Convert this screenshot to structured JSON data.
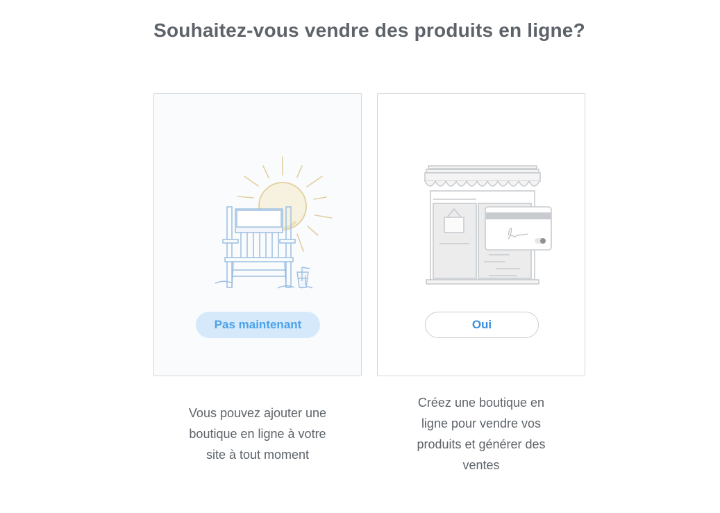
{
  "heading": "Souhaitez-vous vendre des produits en ligne?",
  "options": [
    {
      "button_label": "Pas maintenant",
      "illustration_icon": "beach-chair-sun-icon",
      "description_lines": [
        "Vous pouvez ajouter une",
        "boutique en ligne à votre",
        "site à tout moment"
      ]
    },
    {
      "button_label": "Oui",
      "illustration_icon": "storefront-card-icon",
      "description_lines": [
        "Créez une boutique en",
        "ligne pour vendre vos",
        "produits et générer des",
        "ventes"
      ]
    }
  ],
  "colors": {
    "heading_text": "#5d6369",
    "primary_blue": "#3a8fdc",
    "not_now_bg": "#d6e9fb",
    "card_border": "#d3d7db"
  }
}
